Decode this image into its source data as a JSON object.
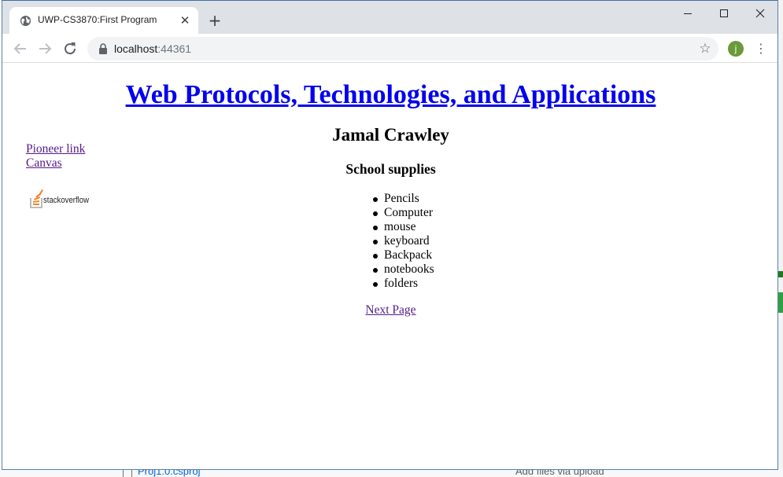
{
  "browser": {
    "tab_title": "UWP-CS3870:First Program",
    "tab_close": "✕",
    "new_tab": "+",
    "url_host": "localhost",
    "url_port": ":44361",
    "avatar_letter": "j",
    "window_controls": {
      "minimize": "—",
      "maximize": "☐",
      "close": "✕"
    }
  },
  "page": {
    "title": "Web Protocols, Technologies, and Applications",
    "author": "Jamal Crawley",
    "side_links": [
      "Pioneer link",
      "Canvas"
    ],
    "logo_text": "stackoverflow",
    "section_heading": "School supplies",
    "supplies": [
      "Pencils",
      "Computer",
      "mouse",
      "keyboard",
      "Backpack",
      "notebooks",
      "folders"
    ],
    "next_link": "Next Page"
  },
  "background": {
    "file_link": "Proj1.0.csproj",
    "upload_text": "Add files via upload"
  },
  "colors": {
    "link": "#0000ee",
    "visited_link": "#551a8b",
    "tabstrip": "#dee1e6",
    "omnibox": "#f1f3f4",
    "avatar": "#6a9a3a"
  }
}
